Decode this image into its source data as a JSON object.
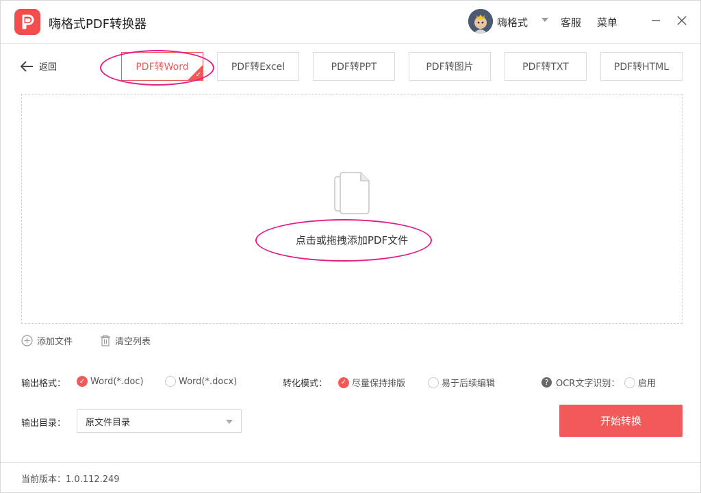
{
  "app": {
    "title": "嗨格式PDF转换器",
    "logo_letter": "P"
  },
  "header": {
    "user_name": "嗨格式",
    "service_label": "客服",
    "menu_label": "菜单"
  },
  "nav": {
    "back_label": "返回",
    "tabs": [
      {
        "label": "PDF转Word",
        "active": true
      },
      {
        "label": "PDF转Excel",
        "active": false
      },
      {
        "label": "PDF转PPT",
        "active": false
      },
      {
        "label": "PDF转图片",
        "active": false
      },
      {
        "label": "PDF转TXT",
        "active": false
      },
      {
        "label": "PDF转HTML",
        "active": false
      }
    ]
  },
  "dropzone": {
    "text": "点击或拖拽添加PDF文件"
  },
  "file_actions": {
    "add_label": "添加文件",
    "clear_label": "清空列表"
  },
  "options": {
    "output_format_label": "输出格式：",
    "format_doc": "Word(*.doc)",
    "format_docx": "Word(*.docx)",
    "mode_label": "转化模式：",
    "mode_keep_layout": "尽量保持排版",
    "mode_easy_edit": "易于后续编辑",
    "ocr_label": "OCR文字识别：",
    "ocr_enable": "启用",
    "output_dir_label": "输出目录：",
    "output_dir_value": "原文件目录"
  },
  "actions": {
    "start_label": "开始转换"
  },
  "footer": {
    "version_label": "当前版本：",
    "version_value": "1.0.112.249"
  },
  "colors": {
    "accent": "#f25a5a",
    "highlight": "#e0208a"
  }
}
